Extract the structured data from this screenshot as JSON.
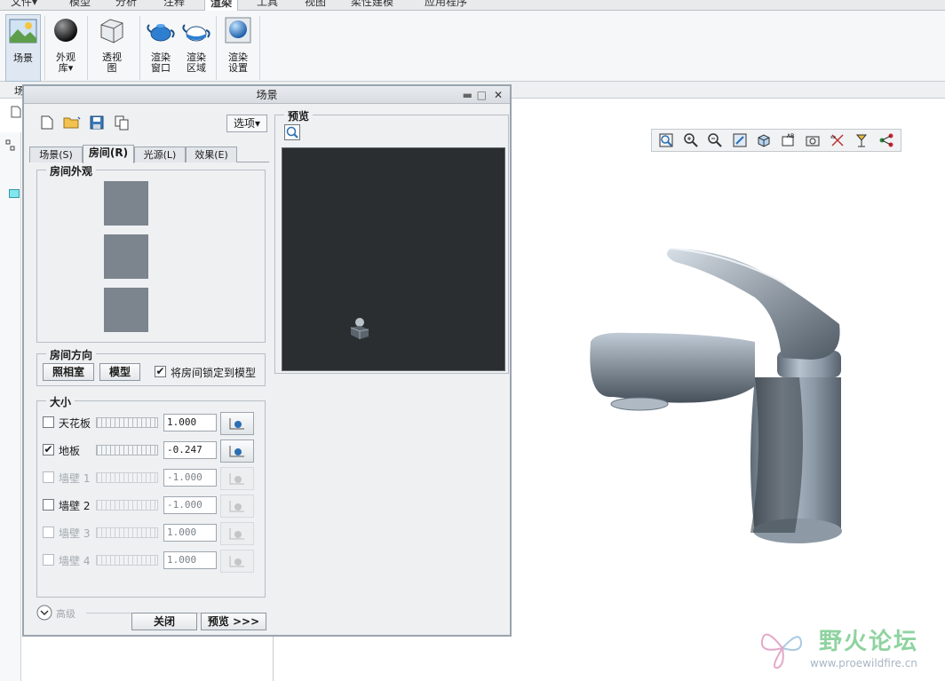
{
  "ribbon_tabs": [
    {
      "label": "文件▾"
    },
    {
      "label": "模型"
    },
    {
      "label": "分析"
    },
    {
      "label": "注释"
    },
    {
      "label": "渲染"
    },
    {
      "label": "工具"
    },
    {
      "label": "视图"
    },
    {
      "label": "柔性建模"
    },
    {
      "label": "应用程序"
    }
  ],
  "ribbon": {
    "scene": "场景",
    "appearance": "外观",
    "appearance2": "库▾",
    "persp": "透视",
    "persp2": "图",
    "render_win": "渲染",
    "render_win2": "窗口",
    "render_reg": "渲染",
    "render_reg2": "区域",
    "render_set": "渲染",
    "render_set2": "设置"
  },
  "subbar_label": "场",
  "dialog": {
    "title": "场景",
    "options_label": "选项▾",
    "tabs": [
      "场景(S)",
      "房间(R)",
      "光源(L)",
      "效果(E)"
    ],
    "room_appearance_label": "房间外观",
    "room_direction_label": "房间方向",
    "studio_button": "照相室",
    "model_button": "模型",
    "lock_label": "将房间锁定到模型",
    "size_label": "大小",
    "size_rows": [
      {
        "label": "天花板",
        "value": "1.000",
        "checked": false,
        "enabled": true
      },
      {
        "label": "地板",
        "value": "-0.247",
        "checked": true,
        "enabled": true
      },
      {
        "label": "墙壁 1",
        "value": "-1.000",
        "checked": false,
        "enabled": false
      },
      {
        "label": "墙壁 2",
        "value": "-1.000",
        "checked": false,
        "enabled": true
      },
      {
        "label": "墙壁 3",
        "value": "1.000",
        "checked": false,
        "enabled": false
      },
      {
        "label": "墙壁 4",
        "value": "1.000",
        "checked": false,
        "enabled": false
      }
    ],
    "advanced_label": "高级",
    "close_button": "关闭",
    "preview_button": "预览 >>>",
    "preview_group_label": "预览"
  },
  "watermark": {
    "title": "野火论坛",
    "url": "www.proewildfire.cn"
  },
  "colors": {
    "accent": "#3f7fbf",
    "model": "#9aa7b4",
    "preview_bg": "#2a2e31"
  }
}
